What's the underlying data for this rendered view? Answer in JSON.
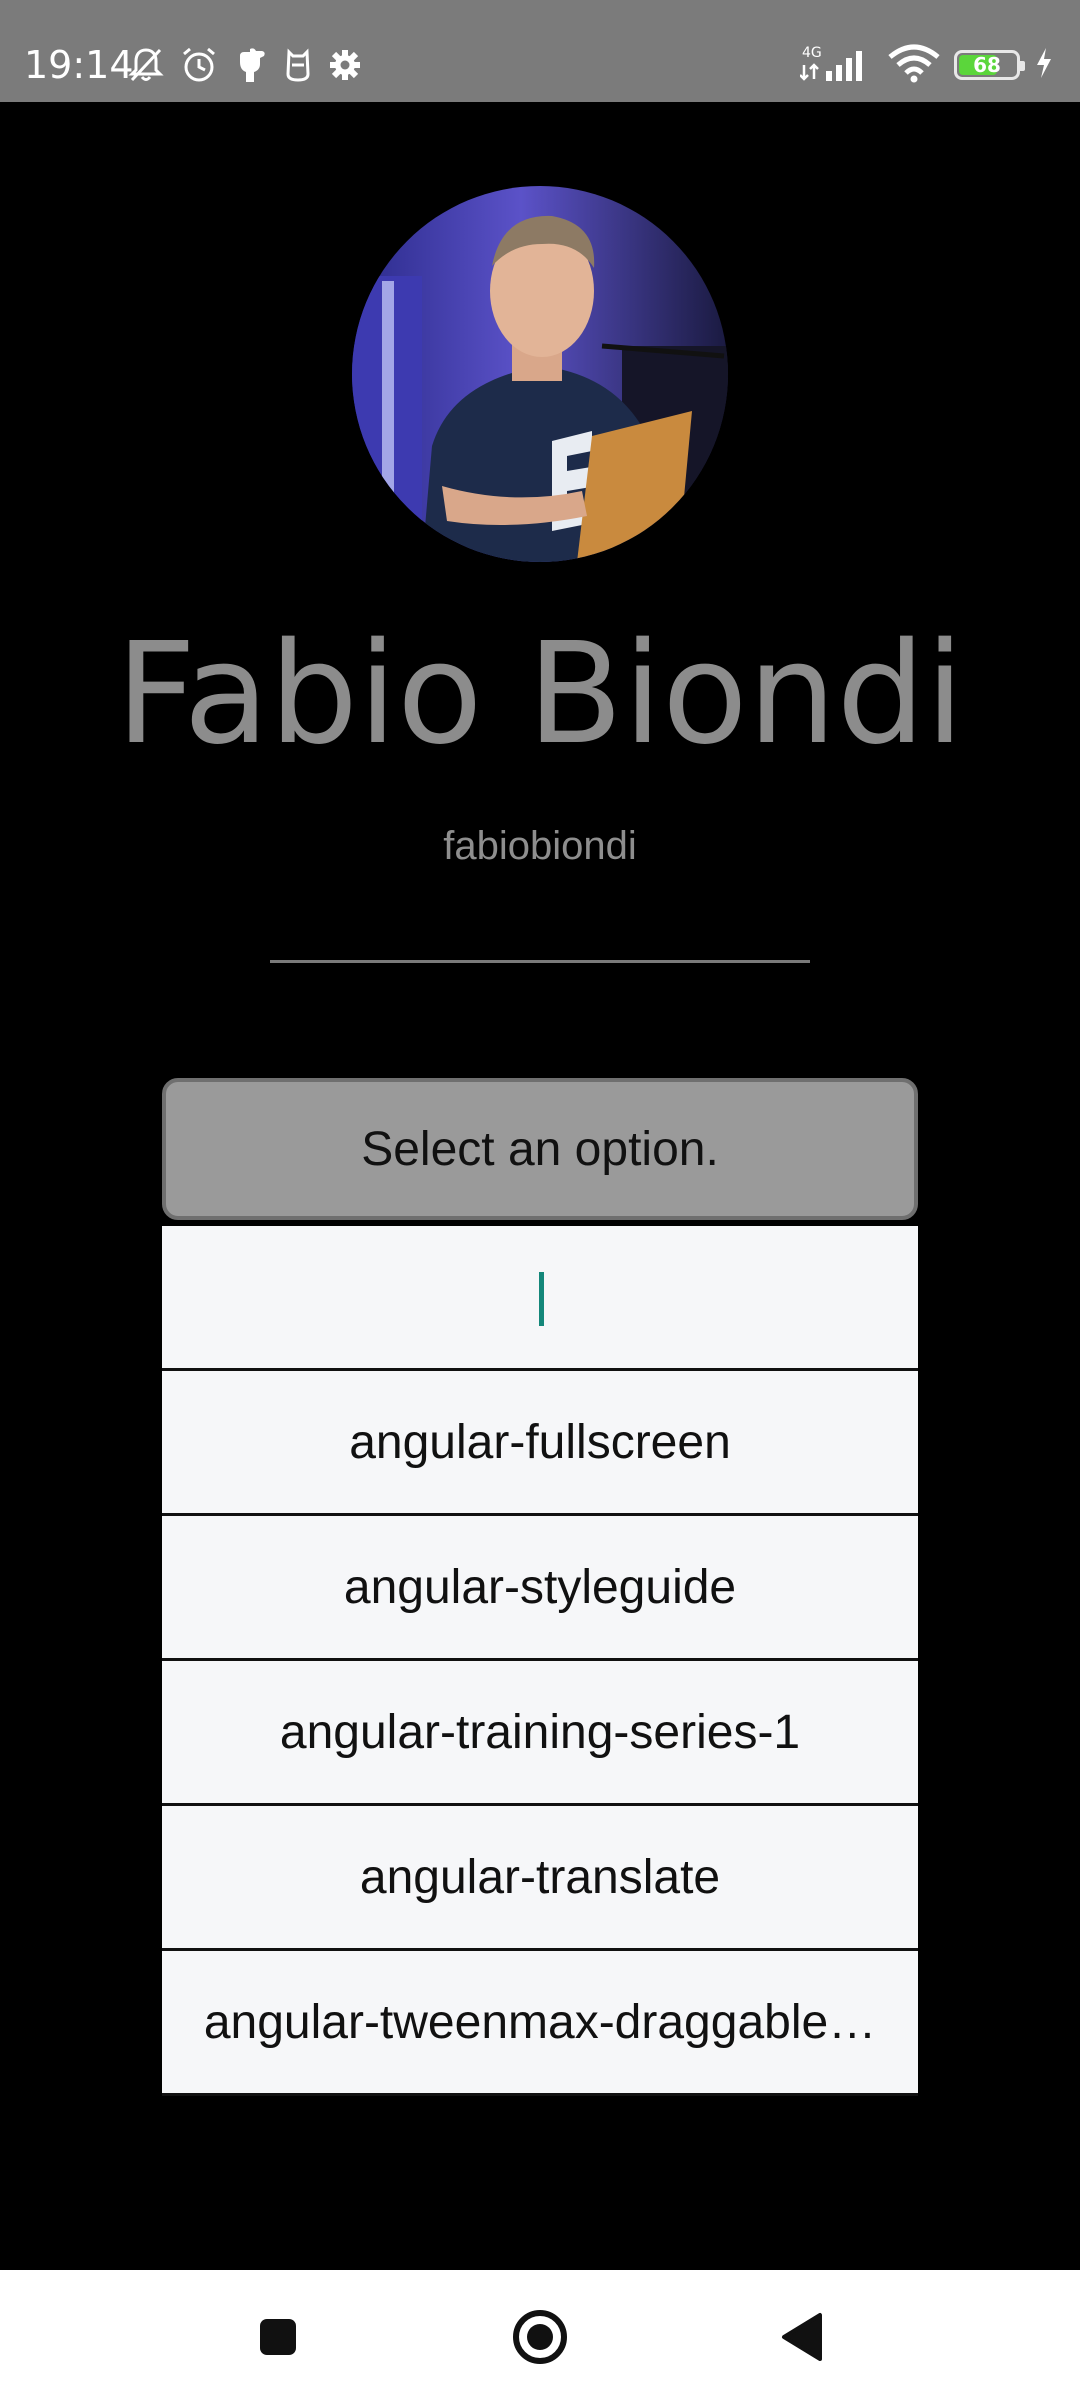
{
  "status_bar": {
    "time": "19:14",
    "network": "4G",
    "battery_level": "68",
    "battery_fraction": 0.68,
    "left_icons": [
      "bell-off-icon",
      "alarm-icon",
      "hand-icon",
      "cat-icon",
      "gear-icon"
    ],
    "right_icons": [
      "signal-icon",
      "wifi-icon",
      "battery-icon",
      "charging-icon"
    ]
  },
  "profile": {
    "name": "Fabio Biondi",
    "username": "fabiobiondi"
  },
  "select": {
    "label": "Select an option.",
    "search_value": "",
    "options": [
      "angular-fullscreen",
      "angular-styleguide",
      "angular-training-series-1",
      "angular-translate",
      "angular-tweenmax-draggable…"
    ]
  },
  "nav_bar": {
    "buttons": [
      "recents-button",
      "home-button",
      "back-button"
    ]
  },
  "colors": {
    "status_bar_bg": "#7b7b7b",
    "background": "#000000",
    "name_text": "#8c8c8c",
    "select_bg": "#9a9a9a",
    "list_bg": "#f6f7f9",
    "caret": "#14877a",
    "battery_fill": "#5bd63b"
  }
}
